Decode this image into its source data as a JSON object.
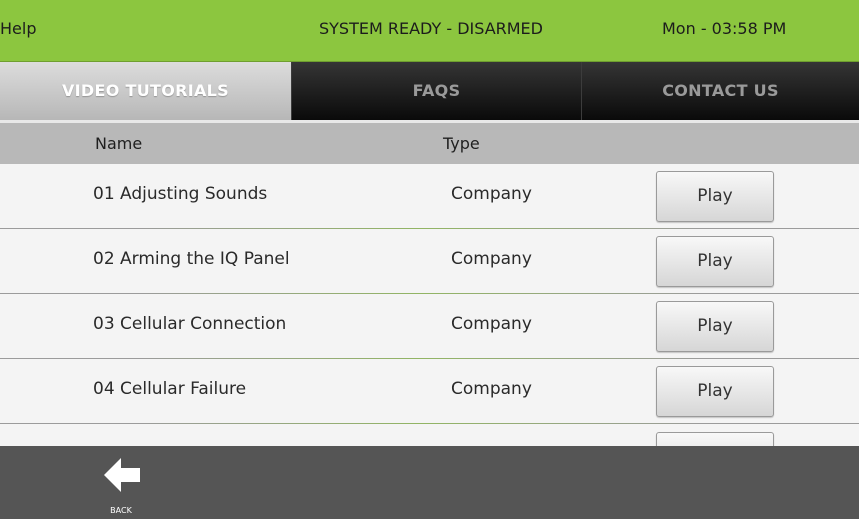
{
  "header": {
    "title": "Help",
    "status": "SYSTEM READY - DISARMED",
    "datetime": "Mon - 03:58 PM",
    "accent_color": "#8cc63f"
  },
  "tabs": [
    {
      "label": "VIDEO TUTORIALS",
      "active": true
    },
    {
      "label": "FAQS",
      "active": false
    },
    {
      "label": "CONTACT US",
      "active": false
    }
  ],
  "table": {
    "columns": [
      "Name",
      "Type"
    ],
    "rows": [
      {
        "name": "01 Adjusting Sounds",
        "type": "Company",
        "action": "Play"
      },
      {
        "name": "02 Arming the IQ Panel",
        "type": "Company",
        "action": "Play"
      },
      {
        "name": "03 Cellular Connection",
        "type": "Company",
        "action": "Play"
      },
      {
        "name": "04 Cellular Failure",
        "type": "Company",
        "action": "Play"
      }
    ]
  },
  "footer": {
    "back_label": "BACK",
    "back_icon": "arrow-left-icon"
  }
}
